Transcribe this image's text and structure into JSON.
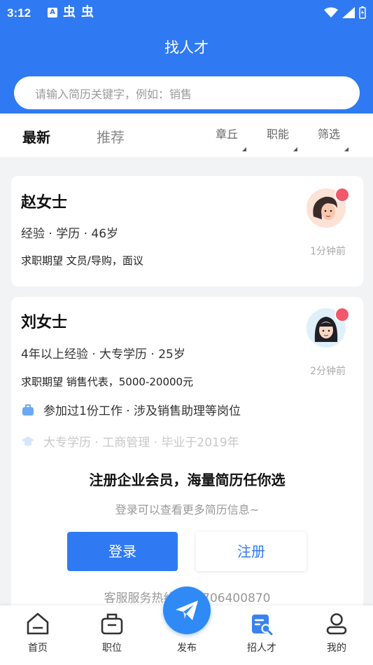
{
  "status_bar": {
    "time": "3:12",
    "bug_glyph": "虫"
  },
  "header": {
    "title": "找人才",
    "search_placeholder": "请输入简历关键字，例如：销售"
  },
  "tabs": {
    "latest": "最新",
    "recommended": "推荐"
  },
  "filters": {
    "region": "章丘",
    "job": "职能",
    "screen": "筛选"
  },
  "candidates": [
    {
      "name": "赵女士",
      "info": "经验 · 学历 · 46岁",
      "intent": "求职期望 文员/导购，面议",
      "time": "1分钟前"
    },
    {
      "name": "刘女士",
      "info": "4年以上经验 · 大专学历 · 25岁",
      "intent": "求职期望 销售代表，5000-20000元",
      "time": "2分钟前",
      "work": "参加过1份工作 · 涉及销售助理等岗位",
      "education": "大专学历 · 工商管理 · 毕业于2019年"
    }
  ],
  "register_prompt": {
    "title": "注册企业会员，海量简历任你选",
    "subtitle": "登录可以查看更多简历信息~",
    "login_label": "登录",
    "register_label": "注册",
    "hotline": "客服服务热线：13706400870"
  },
  "bottom_nav": {
    "home": "首页",
    "jobs": "职位",
    "publish": "发布",
    "talent": "招人才",
    "mine": "我的"
  },
  "colors": {
    "brand": "#2f7af2",
    "badge": "#f1586b"
  }
}
